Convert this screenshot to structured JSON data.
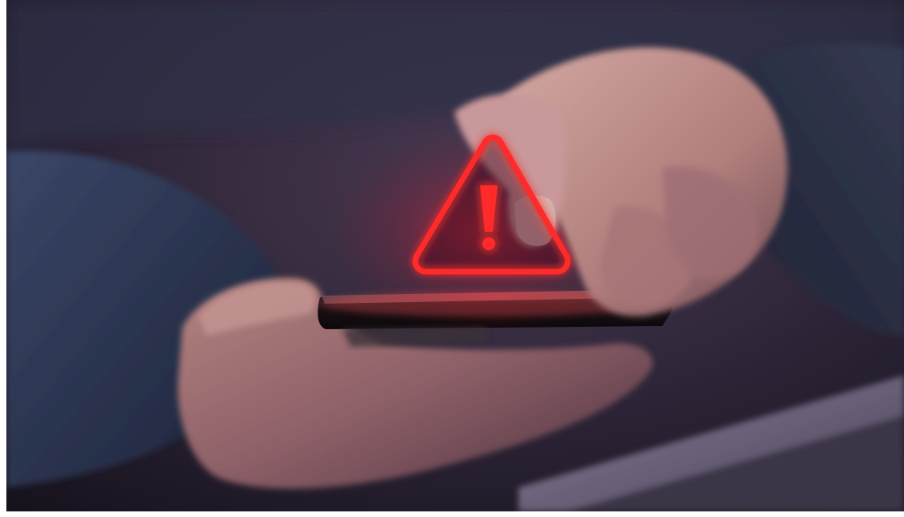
{
  "photo": {
    "subject": "hands-holding-smartphone-warning",
    "icons": [
      "warning-triangle-icon"
    ],
    "colors": {
      "background": "#2a2238",
      "sleeve": "#2c3350",
      "skin": "#b98a86",
      "phone": "#1a1418",
      "alert_red": "#ff2a2a",
      "laptop": "#5e5670"
    }
  }
}
